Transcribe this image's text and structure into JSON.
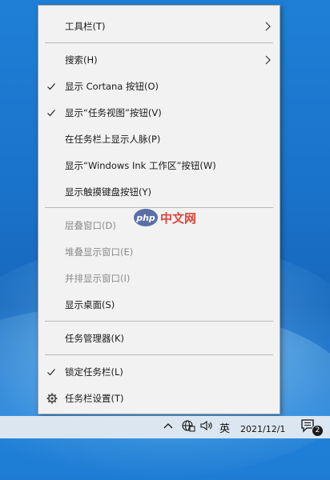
{
  "menu": {
    "items": [
      {
        "label": "工具栏(T)",
        "checked": false,
        "submenu": true,
        "enabled": true
      },
      {
        "label": "搜索(H)",
        "checked": false,
        "submenu": true,
        "enabled": true
      },
      {
        "label": "显示 Cortana 按钮(O)",
        "checked": true,
        "submenu": false,
        "enabled": true
      },
      {
        "label": "显示“任务视图”按钮(V)",
        "checked": true,
        "submenu": false,
        "enabled": true
      },
      {
        "label": "在任务栏上显示人脉(P)",
        "checked": false,
        "submenu": false,
        "enabled": true
      },
      {
        "label": "显示“Windows Ink 工作区”按钮(W)",
        "checked": false,
        "submenu": false,
        "enabled": true
      },
      {
        "label": "显示触摸键盘按钮(Y)",
        "checked": false,
        "submenu": false,
        "enabled": true
      },
      {
        "label": "层叠窗口(D)",
        "checked": false,
        "submenu": false,
        "enabled": false
      },
      {
        "label": "堆叠显示窗口(E)",
        "checked": false,
        "submenu": false,
        "enabled": false
      },
      {
        "label": "并排显示窗口(I)",
        "checked": false,
        "submenu": false,
        "enabled": false
      },
      {
        "label": "显示桌面(S)",
        "checked": false,
        "submenu": false,
        "enabled": true
      },
      {
        "label": "任务管理器(K)",
        "checked": false,
        "submenu": false,
        "enabled": true
      },
      {
        "label": "锁定任务栏(L)",
        "checked": true,
        "submenu": false,
        "enabled": true
      },
      {
        "label": "任务栏设置(T)",
        "checked": false,
        "submenu": false,
        "enabled": true,
        "icon": "gear-icon"
      }
    ]
  },
  "taskbar": {
    "ime": "英",
    "date": "2021/12/1",
    "notification_count": "2"
  },
  "watermark": {
    "logo": "php",
    "text": "中文网"
  },
  "colors": {
    "menu_bg": "#f2f2f2",
    "disabled_text": "#8a8a8a",
    "desktop_blue": "#1a72c9"
  }
}
